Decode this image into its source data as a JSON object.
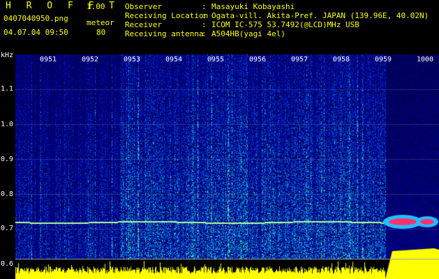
{
  "app": {
    "title": "H R O F F T",
    "version": "1.00"
  },
  "header": {
    "filename": "0407040950.png",
    "mode": "meteor",
    "datetime": "04.07.04 09:50",
    "count": "80"
  },
  "info": [
    {
      "label": "Observer",
      "value": "Masayuki Kobayashi"
    },
    {
      "label": "Receiving Location",
      "value": "Ogata-vill. Akita-Pref. JAPAN (139.96E, 40.02N)"
    },
    {
      "label": "Receiver",
      "value": "ICOM IC-575 53.7492(@LCD)MHz USB"
    },
    {
      "label": "Receiving antenna",
      "value": "A504HB(yagi 4el)"
    }
  ],
  "axis": {
    "y_unit": "kHz",
    "y_ticks": [
      "1.1",
      "1.0",
      "0.9",
      "0.8",
      "0.7",
      "0.6"
    ],
    "x_ticks": [
      "0951",
      "0952",
      "0953",
      "0954",
      "0955",
      "0956",
      "0957",
      "0958",
      "0959",
      "1000"
    ]
  },
  "colors": {
    "text": "#ffff00",
    "axis_text": "#ffffff",
    "background": "#000000",
    "signal_trace": "#ff3070",
    "level_bar": "#ffff00"
  }
}
